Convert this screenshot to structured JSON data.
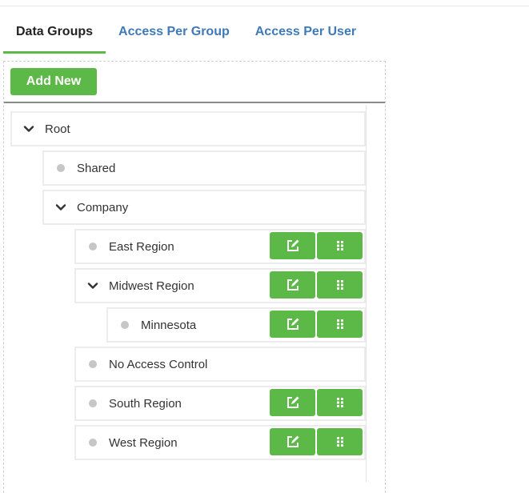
{
  "tabs": [
    {
      "label": "Data Groups",
      "active": true
    },
    {
      "label": "Access Per Group",
      "active": false
    },
    {
      "label": "Access Per User",
      "active": false
    }
  ],
  "toolbar": {
    "add_label": "Add New"
  },
  "tree": {
    "root": {
      "label": "Root",
      "icon": "chevron-down-icon"
    },
    "shared": {
      "label": "Shared",
      "icon": "bullet-icon"
    },
    "company": {
      "label": "Company",
      "icon": "chevron-down-icon"
    },
    "east_region": {
      "label": "East Region",
      "icon": "bullet-icon"
    },
    "midwest_region": {
      "label": "Midwest Region",
      "icon": "chevron-down-icon"
    },
    "minnesota": {
      "label": "Minnesota",
      "icon": "bullet-icon"
    },
    "no_access_control": {
      "label": "No Access Control",
      "icon": "bullet-icon"
    },
    "south_region": {
      "label": "South Region",
      "icon": "bullet-icon"
    },
    "west_region": {
      "label": "West Region",
      "icon": "bullet-icon"
    }
  },
  "row_actions": {
    "edit_icon": "edit-icon",
    "drag_icon": "drag-handle-icon"
  },
  "colors": {
    "accent_green": "#5cb847",
    "tab_link": "#3f7ab8",
    "dot_gray": "#c6c6c6"
  }
}
